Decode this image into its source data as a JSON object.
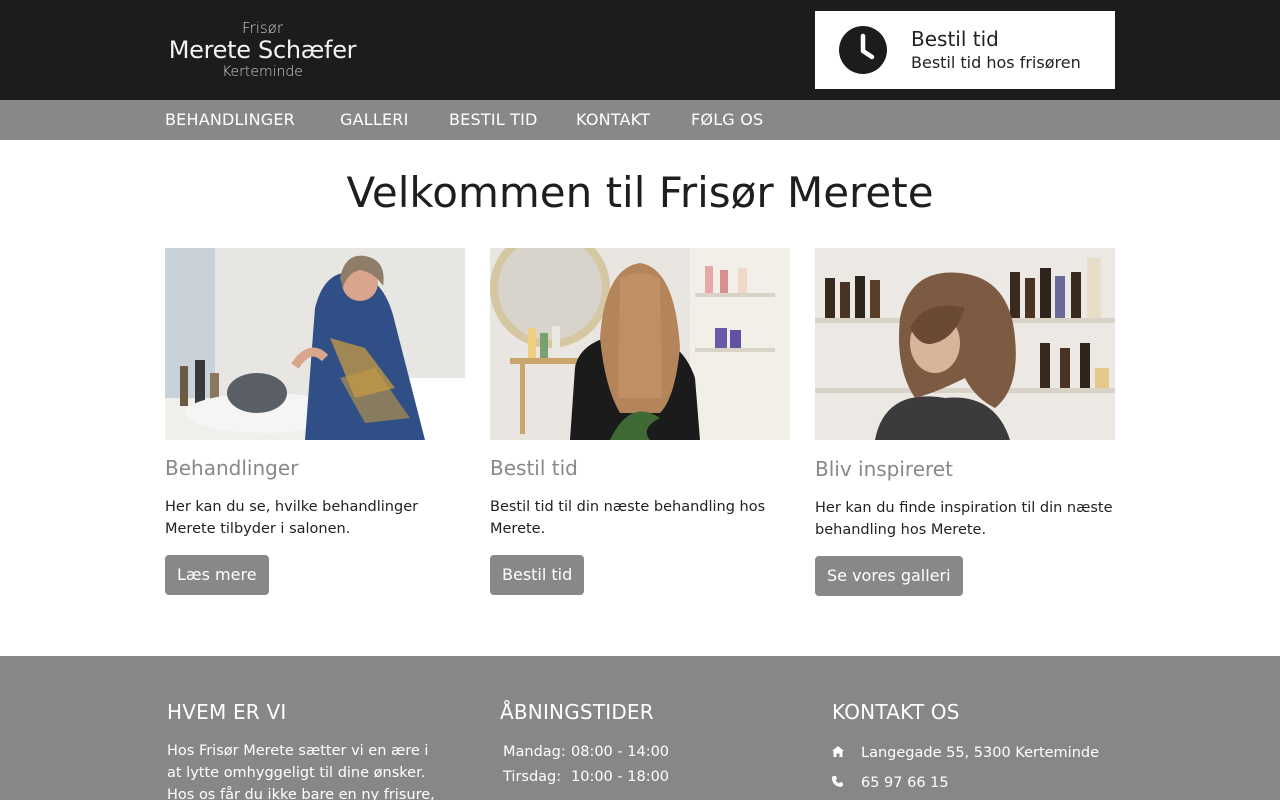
{
  "logo": {
    "line1": "Frisør",
    "line2": "Merete Schæfer",
    "line3": "Kerteminde"
  },
  "booking": {
    "title": "Bestil tid",
    "subtitle": "Bestil tid hos frisøren",
    "icon": "clock-icon"
  },
  "nav": {
    "items": [
      {
        "label": "BEHANDLINGER"
      },
      {
        "label": "GALLERI"
      },
      {
        "label": "BESTIL TID"
      },
      {
        "label": "KONTAKT"
      },
      {
        "label": "FØLG OS"
      }
    ]
  },
  "main": {
    "heading": "Velkommen til Frisør Merete",
    "cards": [
      {
        "title": "Behandlinger",
        "text": "Her kan du se, hvilke behandlinger Merete tilbyder i salonen.",
        "button": "Læs mere"
      },
      {
        "title": "Bestil tid",
        "text": "Bestil tid til din næste behandling hos Merete.",
        "button": "Bestil tid"
      },
      {
        "title": "Bliv inspireret",
        "text": "Her kan du finde inspiration til din næste behandling hos Merete.",
        "button": "Se vores galleri"
      }
    ]
  },
  "footer": {
    "about": {
      "heading": "HVEM ER VI",
      "text": "Hos Frisør Merete sætter vi en ære i at lytte omhyggeligt til dine ønsker. Hos os får du ikke bare en ny frisure, men"
    },
    "hours": {
      "heading": "ÅBNINGSTIDER",
      "rows": [
        {
          "day": "Mandag:",
          "time": "08:00 - 14:00"
        },
        {
          "day": "Tirsdag:",
          "time": "10:00 - 18:00"
        }
      ]
    },
    "contact": {
      "heading": "KONTAKT OS",
      "address": "Langegade 55, 5300 Kerteminde",
      "phone": "65 97 66 15"
    }
  },
  "colors": {
    "header_bg": "#1c1c1c",
    "nav_bg": "#888888",
    "button_bg": "#888888",
    "footer_bg": "#878787"
  }
}
